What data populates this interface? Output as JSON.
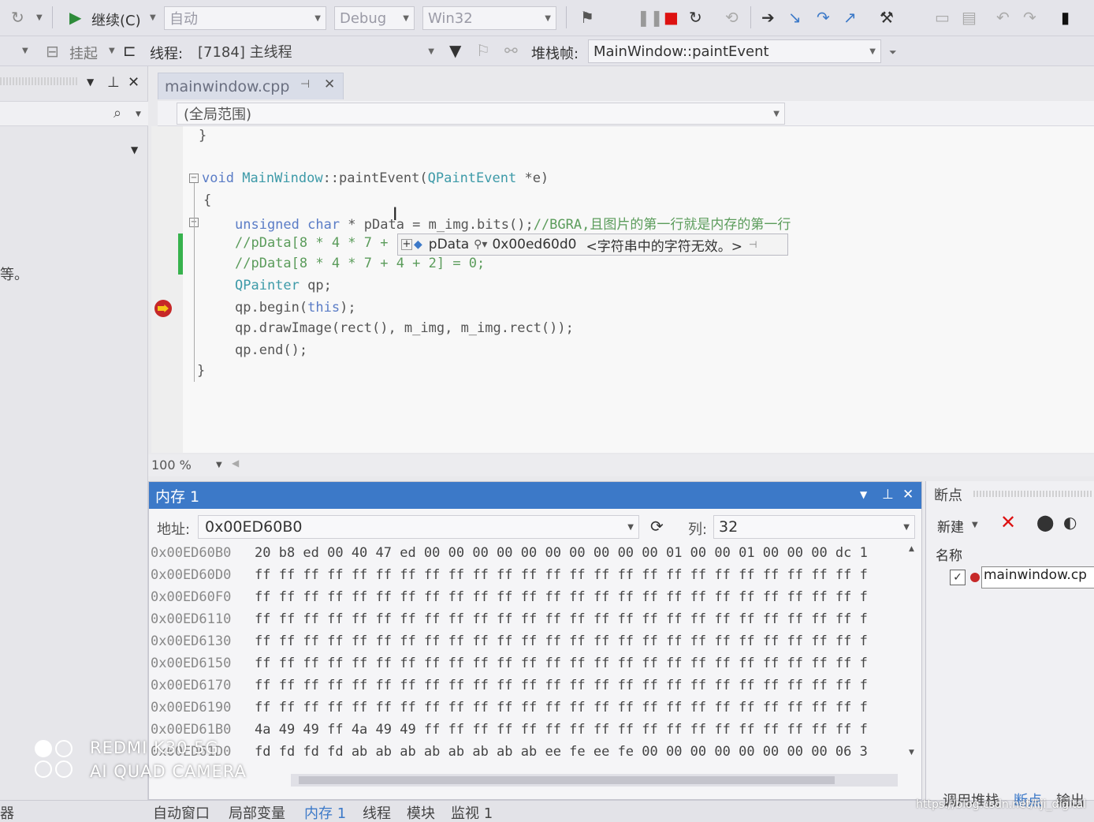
{
  "toolbar1": {
    "continue_label": "继续(C)",
    "auto_combo": "自动",
    "config_combo": "Debug",
    "platform_combo": "Win32"
  },
  "toolbar2": {
    "suspend_label": "挂起",
    "thread_label": "线程:",
    "thread_value": "[7184] 主线程",
    "stackframe_label": "堆栈帧:",
    "stackframe_value": "MainWindow::paintEvent"
  },
  "left_panel": {
    "edge_text": "等。"
  },
  "editor": {
    "file_tab": "mainwindow.cpp",
    "scope": "(全局范围)",
    "zoom": "100 %",
    "code": {
      "l0": "}",
      "l1_kw": "void",
      "l1_ty": "MainWindow",
      "l1_fn": "::paintEvent(",
      "l1_ty2": "QPaintEvent",
      "l1_rest": " *e)",
      "l2": "{",
      "l3_kw": "unsigned char",
      "l3_rest": " * pData = m_img.bits();",
      "l3_cm": "//BGRA,且图片的第一行就是内存的第一行",
      "l4": "//pData[8 * 4 * 7 +",
      "l5": "//pData[8 * 4 * 7 + 4 + 2] = 0;",
      "l6_ty": "QPainter",
      "l6_rest": " qp;",
      "l7_a": "qp.begin(",
      "l7_kw": "this",
      "l7_b": ");",
      "l8": "qp.drawImage(rect(), m_img, m_img.rect());",
      "l9": "qp.end();",
      "l10": "}"
    },
    "datatip": {
      "name": "pData",
      "value": "0x00ed60d0",
      "note": "<字符串中的字符无效。>"
    }
  },
  "memory": {
    "title": "内存 1",
    "address_label": "地址:",
    "address_value": "0x00ED60B0",
    "columns_label": "列:",
    "columns_value": "32",
    "rows": [
      {
        "addr": "0x00ED60B0",
        "bytes": "20 b8 ed 00 40 47 ed 00 00 00 00 00 00 00 00 00 00 01 00 00 01 00 00 00 dc 1"
      },
      {
        "addr": "0x00ED60D0",
        "bytes": "ff ff ff ff ff ff ff ff ff ff ff ff ff ff ff ff ff ff ff ff ff ff ff ff ff f"
      },
      {
        "addr": "0x00ED60F0",
        "bytes": "ff ff ff ff ff ff ff ff ff ff ff ff ff ff ff ff ff ff ff ff ff ff ff ff ff f"
      },
      {
        "addr": "0x00ED6110",
        "bytes": "ff ff ff ff ff ff ff ff ff ff ff ff ff ff ff ff ff ff ff ff ff ff ff ff ff f"
      },
      {
        "addr": "0x00ED6130",
        "bytes": "ff ff ff ff ff ff ff ff ff ff ff ff ff ff ff ff ff ff ff ff ff ff ff ff ff f"
      },
      {
        "addr": "0x00ED6150",
        "bytes": "ff ff ff ff ff ff ff ff ff ff ff ff ff ff ff ff ff ff ff ff ff ff ff ff ff f"
      },
      {
        "addr": "0x00ED6170",
        "bytes": "ff ff ff ff ff ff ff ff ff ff ff ff ff ff ff ff ff ff ff ff ff ff ff ff ff f"
      },
      {
        "addr": "0x00ED6190",
        "bytes": "ff ff ff ff ff ff ff ff ff ff ff ff ff ff ff ff ff ff ff ff ff ff ff ff ff f"
      },
      {
        "addr": "0x00ED61B0",
        "bytes": "4a 49 49 ff 4a 49 49 ff ff ff ff ff ff ff ff ff ff ff ff ff ff ff ff ff ff f"
      },
      {
        "addr": "0x00ED61D0",
        "bytes": "fd fd fd fd ab ab ab ab ab ab ab ab ee fe ee fe 00 00 00 00 00 00 00 00 06 3"
      }
    ]
  },
  "breakpoints": {
    "title": "断点",
    "new_label": "新建",
    "name_header": "名称",
    "item": "mainwindow.cp"
  },
  "bottom_tabs": {
    "left_edge": "器",
    "auto": "自动窗口",
    "locals": "局部变量",
    "memory1": "内存 1",
    "threads": "线程",
    "modules": "模块",
    "watch1": "监视 1",
    "callstack": "调用堆栈",
    "breakpoints": "断点",
    "output": "输出"
  },
  "watermark": {
    "line1": "REDMI K30 5G",
    "line2": "AI QUAD CAMERA"
  },
  "credit": "https://blog.csdn.net/liji_digital",
  "colors": {
    "accent_blue": "#3c79c8",
    "keyword": "#5a7cc6",
    "type": "#3d9aa8",
    "comment": "#5b9c5b",
    "breakpoint": "#c62828"
  }
}
